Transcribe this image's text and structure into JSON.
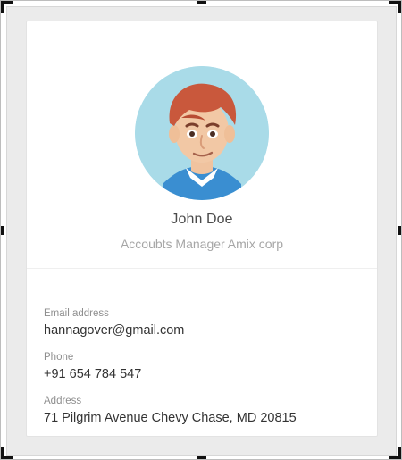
{
  "profile": {
    "name": "John Doe",
    "title": "Accoubts Manager Amix corp"
  },
  "fields": [
    {
      "label": "Email address",
      "value": "hannagover@gmail.com"
    },
    {
      "label": "Phone",
      "value": "+91 654 784 547"
    },
    {
      "label": "Address",
      "value": "71 Pilgrim Avenue Chevy Chase, MD 20815"
    }
  ],
  "colors": {
    "avatar_bg": "#a9dbe8",
    "card_bg": "#ffffff",
    "frame_bg": "#ebebeb"
  },
  "icons": {
    "avatar": "user-avatar-illustration"
  }
}
